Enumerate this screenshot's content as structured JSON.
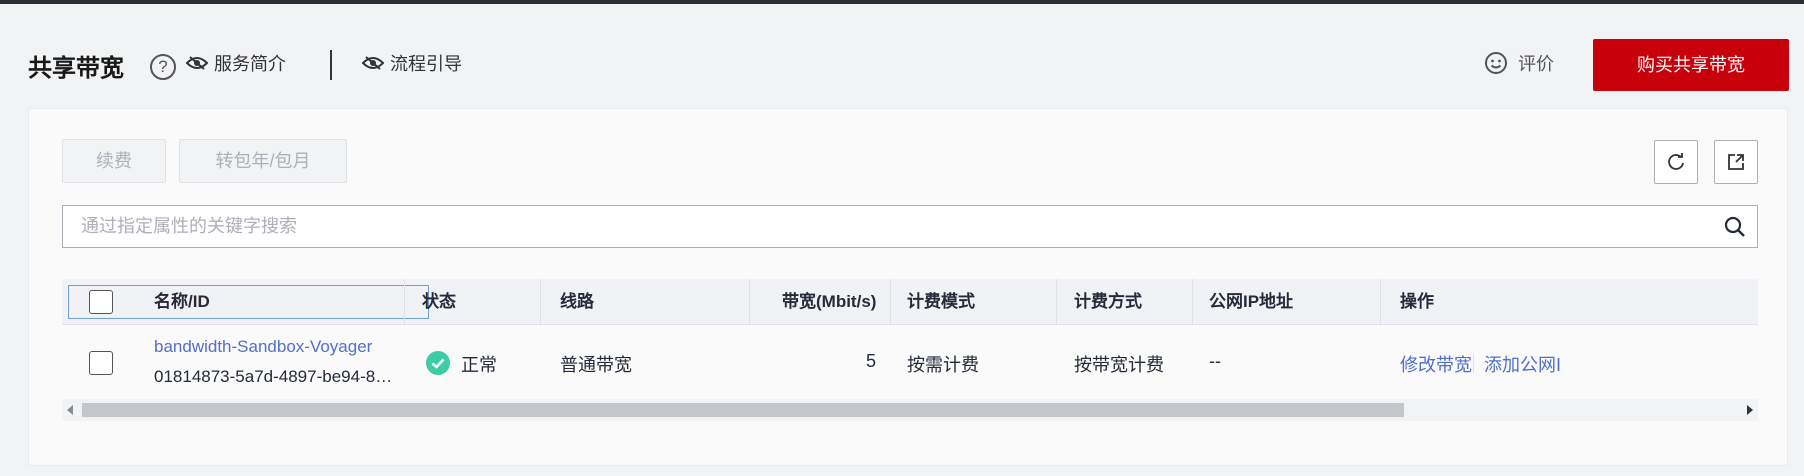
{
  "header": {
    "title": "共享带宽",
    "help_icon": "?",
    "link_service_intro": "服务简介",
    "link_process_guide": "流程引导",
    "rate_label": "评价",
    "buy_button": "购买共享带宽"
  },
  "toolbar": {
    "renew_button": "续费",
    "convert_button": "转包年/包月",
    "refresh_icon": "refresh-icon",
    "export_icon": "export-icon"
  },
  "search": {
    "placeholder": "通过指定属性的关键字搜索"
  },
  "table": {
    "columns": [
      "名称/ID",
      "状态",
      "线路",
      "带宽(Mbit/s)",
      "计费模式",
      "计费方式",
      "公网IP地址",
      "操作"
    ],
    "rows": [
      {
        "name": "bandwidth-Sandbox-Voyager",
        "id": "01814873-5a7d-4897-be94-8…",
        "status": "正常",
        "line": "普通带宽",
        "bandwidth": "5",
        "billing_mode": "按需计费",
        "billing_method": "按带宽计费",
        "public_ip": "--",
        "op_modify": "修改带宽",
        "op_add": "添加公网I"
      }
    ]
  },
  "colors": {
    "accent_red": "#c7000b",
    "link_blue": "#526ecc",
    "status_green": "#3dcca6"
  }
}
